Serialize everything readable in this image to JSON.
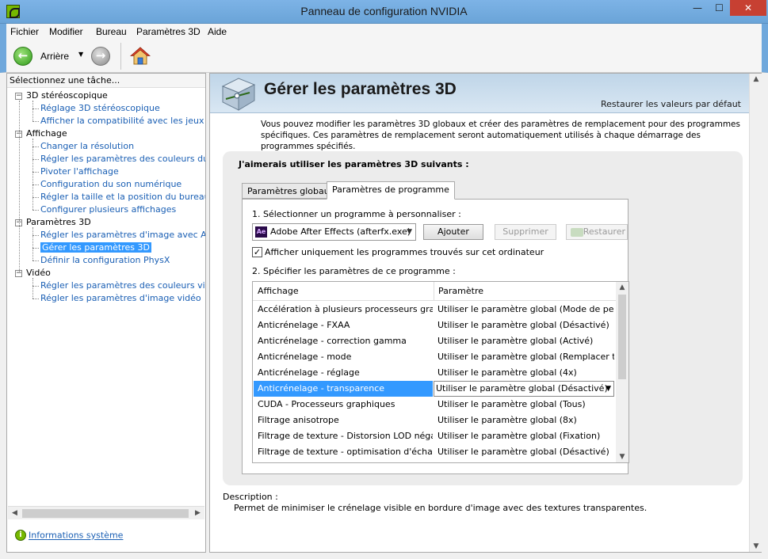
{
  "window": {
    "title": "Panneau de configuration NVIDIA",
    "minimize": "—",
    "maximize": "☐",
    "close": "✕"
  },
  "menu": [
    "Fichier",
    "Modifier",
    "Bureau",
    "Paramètres 3D",
    "Aide"
  ],
  "toolbar": {
    "back_label": "Arrière"
  },
  "sidebar": {
    "header": "Sélectionnez une tâche...",
    "tree": [
      {
        "label": "3D stéréoscopique",
        "type": "category"
      },
      {
        "label": "Réglage 3D stéréoscopique",
        "type": "leaf"
      },
      {
        "label": "Afficher la compatibilité avec les jeux",
        "type": "leaf"
      },
      {
        "label": "Affichage",
        "type": "category"
      },
      {
        "label": "Changer la résolution",
        "type": "leaf"
      },
      {
        "label": "Régler les paramètres des couleurs du bure",
        "type": "leaf"
      },
      {
        "label": "Pivoter l'affichage",
        "type": "leaf"
      },
      {
        "label": "Configuration du son numérique",
        "type": "leaf"
      },
      {
        "label": "Régler la taille et la position du bureau",
        "type": "leaf"
      },
      {
        "label": "Configurer plusieurs affichages",
        "type": "leaf"
      },
      {
        "label": "Paramètres 3D",
        "type": "category"
      },
      {
        "label": "Régler les paramètres d'image avec Aperçu",
        "type": "leaf"
      },
      {
        "label": "Gérer les paramètres 3D",
        "type": "leaf",
        "selected": true
      },
      {
        "label": "Définir la configuration PhysX",
        "type": "leaf"
      },
      {
        "label": "Vidéo",
        "type": "category"
      },
      {
        "label": "Régler les paramètres des couleurs vidéo",
        "type": "leaf"
      },
      {
        "label": "Régler les paramètres d'image vidéo",
        "type": "leaf"
      }
    ],
    "system_info": "Informations système"
  },
  "main": {
    "title": "Gérer les paramètres 3D",
    "restore_defaults": "Restaurer les valeurs par défaut",
    "intro": "Vous pouvez modifier les paramètres 3D globaux et créer des paramètres de remplacement pour des programmes spécifiques. Ces paramètres de remplacement seront automatiquement utilisés à chaque démarrage des programmes spécifiés.",
    "group_title": "J'aimerais utiliser les paramètres 3D suivants :",
    "tabs": [
      {
        "label": "Paramètres globaux",
        "active": false
      },
      {
        "label": "Paramètres de programme",
        "active": true
      }
    ],
    "step1_label": "1. Sélectionner un programme à personnaliser :",
    "program_selected": "Adobe After Effects (afterfx.exe)",
    "program_icon_text": "Ae",
    "add_button": "Ajouter",
    "remove_button": "Supprimer",
    "restore_button": "Restaurer",
    "checkbox_label": "Afficher uniquement les programmes trouvés sur cet ordinateur",
    "checkbox_checked": true,
    "step2_label": "2. Spécifier les paramètres de ce programme :",
    "grid": {
      "headers": [
        "Affichage",
        "Paramètre"
      ],
      "rows": [
        [
          "Accélération à plusieurs processeurs grap...",
          "Utiliser le paramètre global (Mode de perfo..."
        ],
        [
          "Anticrénelage - FXAA",
          "Utiliser le paramètre global (Désactivé)"
        ],
        [
          "Anticrénelage - correction gamma",
          "Utiliser le paramètre global (Activé)"
        ],
        [
          "Anticrénelage - mode",
          "Utiliser le paramètre global (Remplacer tou..."
        ],
        [
          "Anticrénelage - réglage",
          "Utiliser le paramètre global (4x)"
        ],
        [
          "Anticrénelage - transparence",
          "Utiliser le paramètre global (Désactivé)"
        ],
        [
          "CUDA - Processeurs graphiques",
          "Utiliser le paramètre global (Tous)"
        ],
        [
          "Filtrage anisotrope",
          "Utiliser le paramètre global (8x)"
        ],
        [
          "Filtrage de texture - Distorsion LOD négative",
          "Utiliser le paramètre global (Fixation)"
        ],
        [
          "Filtrage de texture - optimisation d'échanti...",
          "Utiliser le paramètre global (Désactivé)"
        ]
      ],
      "selected_row": 5
    },
    "description_label": "Description :",
    "description_text": "Permet de minimiser le crénelage visible en bordure d'image avec des textures transparentes."
  },
  "colors": {
    "titlebar": "#6fa8dc",
    "nvidia_green": "#76b900",
    "link_blue": "#1a5fb4",
    "selection": "#3399ff"
  }
}
